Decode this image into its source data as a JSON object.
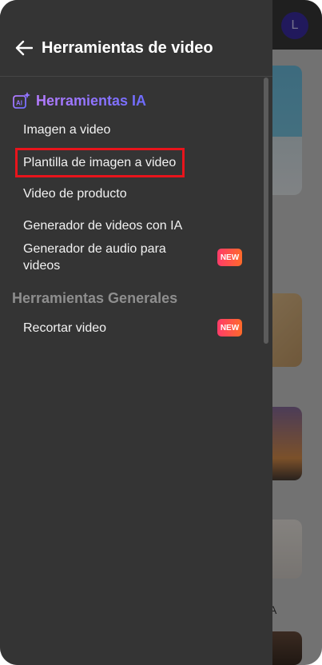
{
  "drawer": {
    "title": "Herramientas de video",
    "back_icon": "arrow-left-icon"
  },
  "sections": {
    "ai": {
      "label": "Herramientas IA",
      "icon": "ai-sparkle-icon",
      "items": [
        {
          "label": "Imagen a video"
        },
        {
          "label": "Plantilla de imagen a video",
          "highlighted": true
        },
        {
          "label": "Video de producto"
        },
        {
          "label": "Generador de videos con IA"
        },
        {
          "label_line1": "Generador de audio para",
          "label_line2": "videos",
          "badge": "NEW"
        }
      ]
    },
    "general": {
      "label": "Herramientas Generales",
      "items": [
        {
          "label": "Recortar video",
          "badge": "NEW"
        }
      ]
    }
  },
  "background": {
    "avatar_letter": "L",
    "partial_text": "A"
  },
  "colors": {
    "drawer_bg": "#343434",
    "accent_gradient_start": "#b57cff",
    "accent_gradient_end": "#6d6cff",
    "badge_start": "#ff3c6a",
    "badge_end": "#ff6a2a",
    "highlight_border": "#e8141c"
  }
}
